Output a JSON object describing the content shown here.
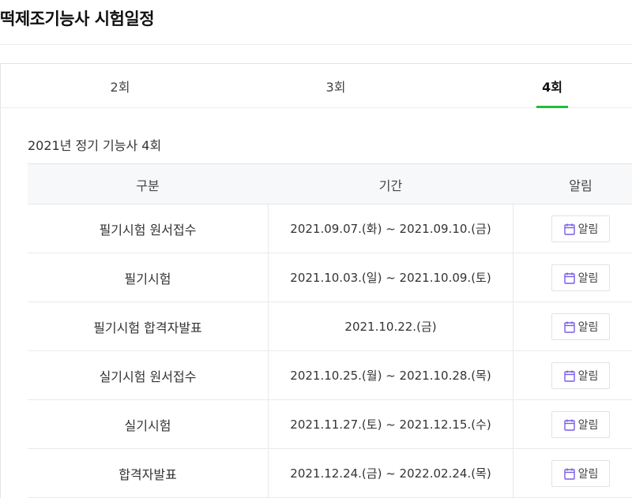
{
  "page": {
    "title": "떡제조기능사 시험일정"
  },
  "tabs": [
    {
      "label": "2회"
    },
    {
      "label": "3회"
    },
    {
      "label": "4회"
    }
  ],
  "active_tab": "4회",
  "section": {
    "heading": "2021년 정기 기능사 4회"
  },
  "table": {
    "headers": [
      "구분",
      "기간",
      "알림"
    ],
    "alarm_label": "알림",
    "rows": [
      {
        "category": "필기시험 원서접수",
        "period": "2021.09.07.(화) ~ 2021.09.10.(금)"
      },
      {
        "category": "필기시험",
        "period": "2021.10.03.(일) ~ 2021.10.09.(토)"
      },
      {
        "category": "필기시험 합격자발표",
        "period": "2021.10.22.(금)"
      },
      {
        "category": "실기시험 원서접수",
        "period": "2021.10.25.(월) ~ 2021.10.28.(목)"
      },
      {
        "category": "실기시험",
        "period": "2021.11.27.(토) ~ 2021.12.15.(수)"
      },
      {
        "category": "합격자발표",
        "period": "2021.12.24.(금) ~ 2022.02.24.(목)"
      }
    ]
  },
  "colors": {
    "accent": "#1fbf39",
    "calendar_icon": "#7b5ce6"
  },
  "icons": {
    "alarm": "calendar-icon"
  }
}
